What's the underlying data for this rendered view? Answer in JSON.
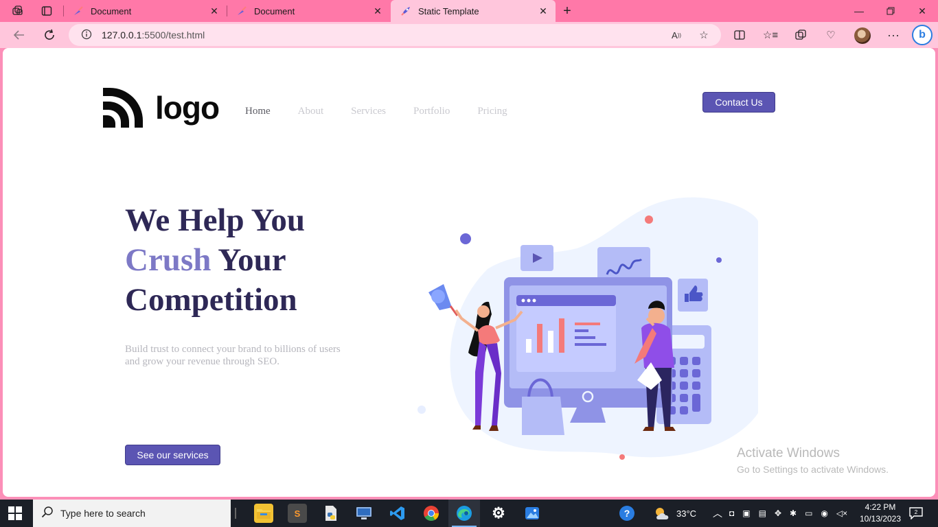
{
  "browser": {
    "tabs": [
      {
        "title": "Document",
        "active": false
      },
      {
        "title": "Document",
        "active": false
      },
      {
        "title": "Static Template",
        "active": true
      }
    ],
    "url_host": "127.0.0.1",
    "url_rest": ":5500/test.html",
    "icons": {
      "workspaces": "workspaces-icon",
      "tab_actions": "tab-actions-icon",
      "new_tab": "plus-icon",
      "back": "back-arrow-icon",
      "refresh": "refresh-icon",
      "site_info": "info-icon",
      "read_aloud": "read-aloud-icon",
      "favorite": "star-icon",
      "split_screen": "split-screen-icon",
      "favorites": "favorites-icon",
      "collections": "collections-icon",
      "performance": "heart-icon",
      "profile": "avatar",
      "more": "more-icon",
      "copilot": "bing-icon"
    }
  },
  "site": {
    "logo_text": "logo",
    "nav": [
      {
        "label": "Home",
        "active": true
      },
      {
        "label": "About",
        "active": false
      },
      {
        "label": "Services",
        "active": false
      },
      {
        "label": "Portfolio",
        "active": false
      },
      {
        "label": "Pricing",
        "active": false
      }
    ],
    "contact_label": "Contact Us",
    "hero": {
      "line1": "We Help You",
      "accent": "Crush",
      "line2_rest": " Your",
      "line3": "Competition",
      "subtitle": "Build trust to connect your brand to billions of users and grow your revenue through SEO.",
      "cta_label": "See our services"
    },
    "colors": {
      "primary": "#5b55b3",
      "heading": "#2e2856",
      "accent": "#7d79c6"
    }
  },
  "watermark": {
    "line1": "Activate Windows",
    "line2": "Go to Settings to activate Windows."
  },
  "taskbar": {
    "search_placeholder": "Type here to search",
    "weather": "33°C",
    "time": "4:22 PM",
    "date": "10/13/2023"
  }
}
